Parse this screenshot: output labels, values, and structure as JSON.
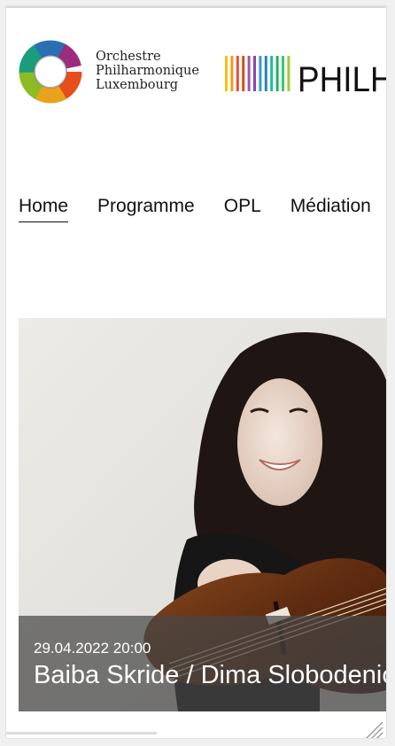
{
  "header": {
    "opl_logo": {
      "line1": "Orchestre",
      "line2": "Philharmonique",
      "line3": "Luxembourg",
      "icon": "opl-ring-icon"
    },
    "phil_logo": {
      "text": "PHILHAR",
      "icon": "philharmonie-bars-icon",
      "bar_colors": [
        "#f1c40f",
        "#f39c12",
        "#e74c3c",
        "#d35400",
        "#9b59b6",
        "#8e44ad",
        "#3498db",
        "#2980b9",
        "#1abc9c",
        "#27ae60",
        "#2ecc71",
        "#a3cb38"
      ]
    }
  },
  "nav": {
    "items": [
      "Home",
      "Programme",
      "OPL",
      "Médiation"
    ],
    "active": "Home"
  },
  "hero": {
    "date": "29.04.2022 20:00",
    "title": "Baiba Skride / Dima Slobodeniouk"
  }
}
